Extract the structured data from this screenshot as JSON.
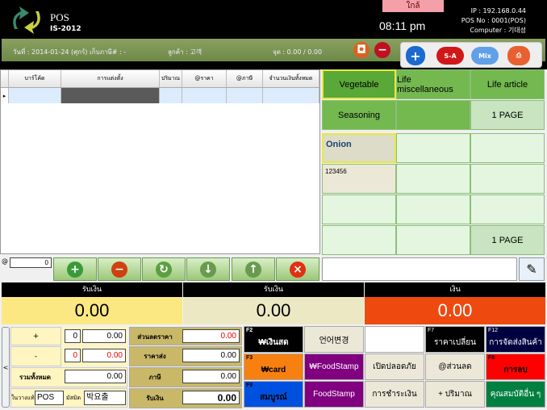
{
  "header": {
    "app_name": "POS",
    "app_version": "IS-2012",
    "close_label": "ใกล้",
    "time": "08:11 pm",
    "ip": "IP : 192.168.0.44",
    "pos_no": "POS No : 0001(POS)",
    "computer": "Computer : 기대성"
  },
  "info_bar": {
    "date": "วันที่ : 2014-01-24  (ศุกร์)  เก็บภาษี# :  -",
    "customer": "ลูกค้า : 고객",
    "points": "จุด : 0.00 / 0.00",
    "sa_label": "S-A",
    "mix_label": "Mix"
  },
  "table": {
    "columns": [
      "บาร์โค้ด",
      "การแต่งตั้ง",
      "ปริมาณ",
      "@ราคา",
      "@ภาษี",
      "จำนวนเงินทั้งหมด"
    ]
  },
  "categories": {
    "row1": [
      "Vegetable",
      "Life miscellaneous",
      "Life article"
    ],
    "row2": [
      "Seasoning",
      "",
      "1 PAGE"
    ],
    "products": [
      {
        "name": "Onion",
        "code": ""
      },
      {
        "name": "",
        "code": "123456"
      }
    ],
    "page_label": "1 PAGE"
  },
  "qty_input": {
    "prefix": "@",
    "value": "0"
  },
  "totals": [
    {
      "label": "รับเงิน",
      "value": "0.00",
      "color": "#fce882"
    },
    {
      "label": "รับเงิน",
      "value": "0.00",
      "color": "#ece8c4"
    },
    {
      "label": "เงิน",
      "value": "0.00",
      "color": "#ee4a10"
    }
  ],
  "adjust": {
    "plus_label": "+",
    "plus_qty": "0",
    "plus_amt": "0.00",
    "minus_label": "-",
    "minus_qty": "0",
    "minus_amt": "0.00",
    "total_label": "รวมทั้งหมด",
    "total_amt": "0.00",
    "pos_label": "ในวางแท้",
    "pos_value": "POS",
    "staff_label": "มัสมิด",
    "staff_value": "박요출"
  },
  "summary": [
    {
      "label": "ส่วนลดราคา",
      "value": "0.00"
    },
    {
      "label": "ราคาส่ง",
      "value": "0.00"
    },
    {
      "label": "ภาษี",
      "value": "0.00"
    },
    {
      "label": "รับเงิน",
      "value": "0.00"
    }
  ],
  "fkeys": [
    {
      "key": "F2",
      "label": "₩เงินสด",
      "bg": "#000000",
      "fg": "#ffffff"
    },
    {
      "key": "",
      "label": "언어변경",
      "bg": "#ece8d8",
      "fg": "#000000"
    },
    {
      "key": "",
      "label": "",
      "bg": "#ffffff",
      "fg": "#000000"
    },
    {
      "key": "F7",
      "label": "ราคาเปลี่ยน",
      "bg": "#000000",
      "fg": "#ffffff"
    },
    {
      "key": "F12",
      "label": "การจัดส่งสินค้า",
      "bg": "#000040",
      "fg": "#ffffff"
    },
    {
      "key": "F3",
      "label": "₩card",
      "bg": "#f88010",
      "fg": "#000000"
    },
    {
      "key": "",
      "label": "₩FoodStamp",
      "bg": "#800080",
      "fg": "#ffffff"
    },
    {
      "key": "",
      "label": "เปิดปลอดภัย",
      "bg": "#ece8d8",
      "fg": "#000000"
    },
    {
      "key": "",
      "label": "@ส่วนลด",
      "bg": "#ece8d8",
      "fg": "#000000"
    },
    {
      "key": "F8",
      "label": "การลบ",
      "bg": "#ff0000",
      "fg": "#000000"
    },
    {
      "key": "F9",
      "label": "สมบูรณ์",
      "bg": "#0050e0",
      "fg": "#000000"
    },
    {
      "key": "",
      "label": "FoodStamp",
      "bg": "#800080",
      "fg": "#ffffff"
    },
    {
      "key": "",
      "label": "การชำระเงิน",
      "bg": "#ece8d8",
      "fg": "#000000"
    },
    {
      "key": "",
      "label": "+ ปริมาณ",
      "bg": "#ece8d8",
      "fg": "#000000"
    },
    {
      "key": "",
      "label": "คุณสมบัติอื่น ๆ",
      "bg": "#008040",
      "fg": "#ffffff"
    }
  ]
}
